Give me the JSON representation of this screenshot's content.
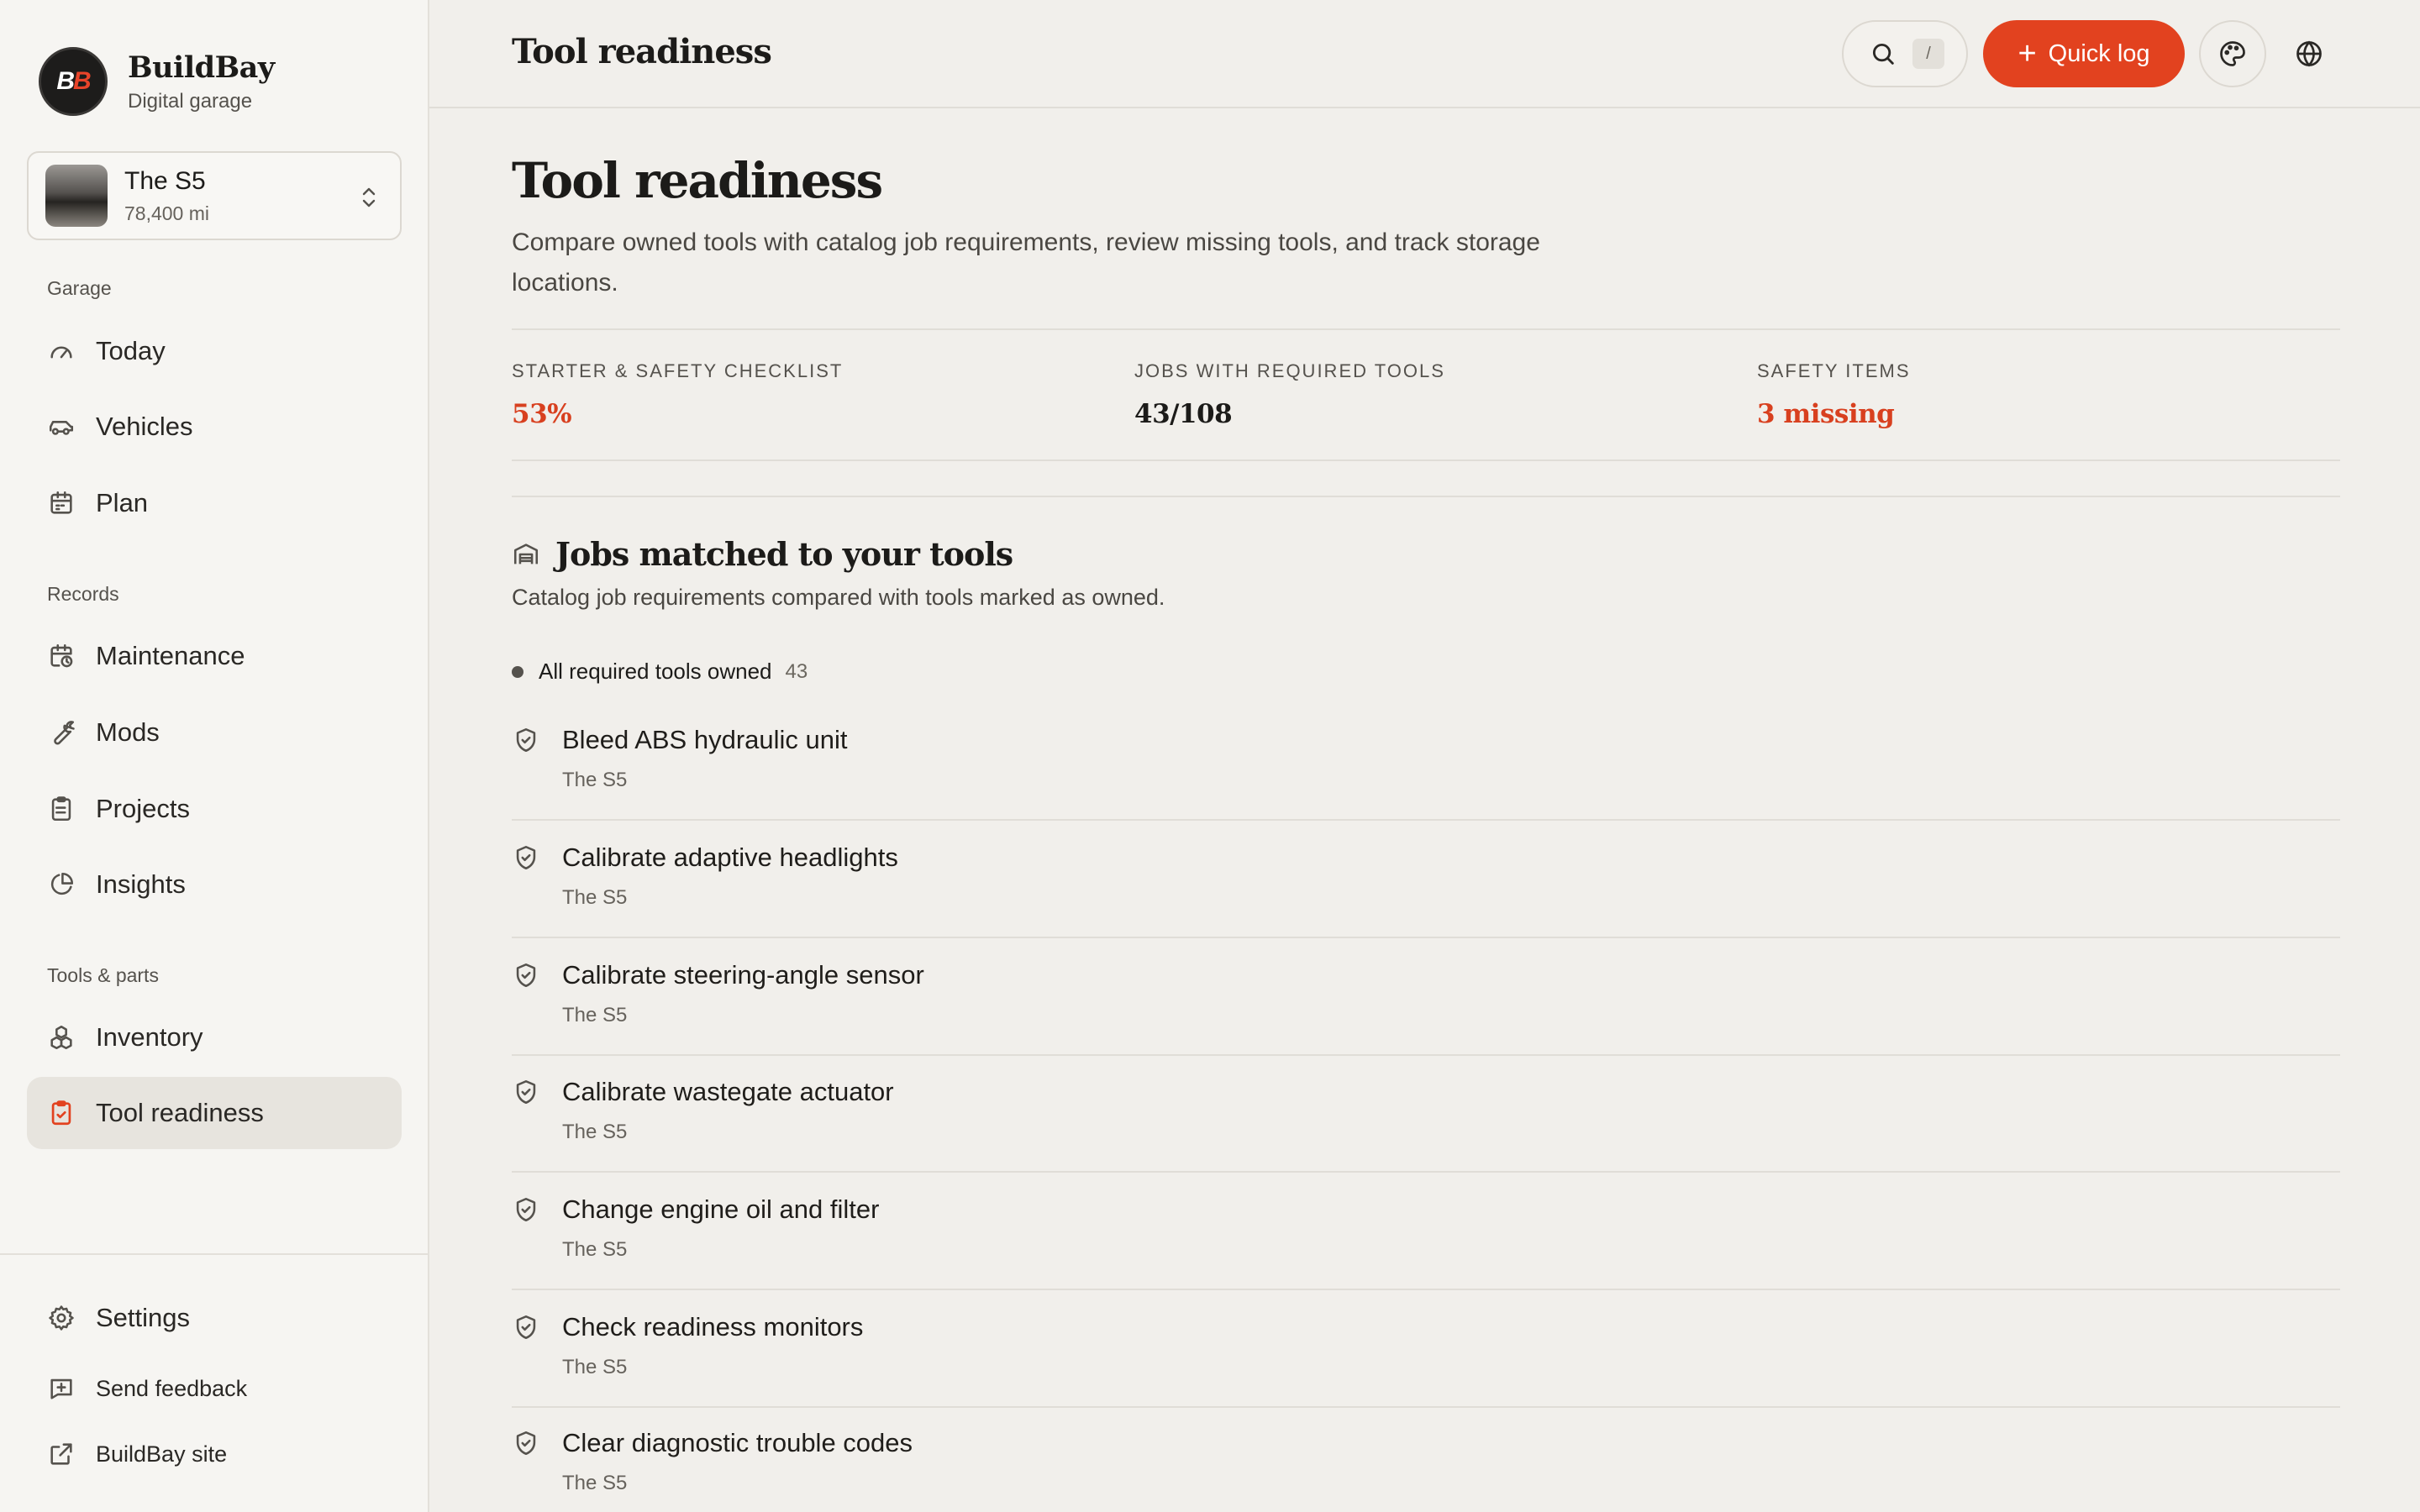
{
  "app": {
    "name": "BuildBay",
    "subtitle": "Digital garage",
    "logo_text_a": "B",
    "logo_text_b": "B"
  },
  "vehicle": {
    "name": "The S5",
    "mileage": "78,400 mi"
  },
  "sidebar": {
    "sections": [
      {
        "title": "Garage",
        "items": [
          {
            "label": "Today",
            "icon": "gauge-icon"
          },
          {
            "label": "Vehicles",
            "icon": "car-icon"
          },
          {
            "label": "Plan",
            "icon": "calendar-icon"
          }
        ]
      },
      {
        "title": "Records",
        "items": [
          {
            "label": "Maintenance",
            "icon": "calendar-clock-icon"
          },
          {
            "label": "Mods",
            "icon": "wrench-icon"
          },
          {
            "label": "Projects",
            "icon": "clipboard-list-icon"
          },
          {
            "label": "Insights",
            "icon": "pie-chart-icon"
          }
        ]
      },
      {
        "title": "Tools & parts",
        "items": [
          {
            "label": "Inventory",
            "icon": "boxes-icon"
          },
          {
            "label": "Tool readiness",
            "icon": "clipboard-check-icon",
            "active": true
          }
        ]
      }
    ],
    "footer": [
      {
        "label": "Settings",
        "icon": "gear-icon"
      },
      {
        "label": "Send feedback",
        "icon": "message-plus-icon"
      },
      {
        "label": "BuildBay site",
        "icon": "external-link-icon"
      }
    ]
  },
  "topbar": {
    "title": "Tool readiness",
    "search_shortcut": "/",
    "quick_log_label": "Quick log"
  },
  "page": {
    "title": "Tool readiness",
    "description": "Compare owned tools with catalog job requirements, review missing tools, and track storage locations."
  },
  "stats": [
    {
      "label": "STARTER & SAFETY CHECKLIST",
      "value": "53%",
      "emphasis": true
    },
    {
      "label": "JOBS WITH REQUIRED TOOLS",
      "value": "43/108",
      "emphasis": false
    },
    {
      "label": "SAFETY ITEMS",
      "value": "3 missing",
      "emphasis": true
    }
  ],
  "jobs_section": {
    "title": "Jobs matched to your tools",
    "subtitle": "Catalog job requirements compared with tools marked as owned.",
    "group_label": "All required tools owned",
    "group_count": "43",
    "jobs": [
      {
        "title": "Bleed ABS hydraulic unit",
        "vehicle": "The S5"
      },
      {
        "title": "Calibrate adaptive headlights",
        "vehicle": "The S5"
      },
      {
        "title": "Calibrate steering-angle sensor",
        "vehicle": "The S5"
      },
      {
        "title": "Calibrate wastegate actuator",
        "vehicle": "The S5"
      },
      {
        "title": "Change engine oil and filter",
        "vehicle": "The S5"
      },
      {
        "title": "Check readiness monitors",
        "vehicle": "The S5"
      },
      {
        "title": "Clear diagnostic trouble codes",
        "vehicle": "The S5"
      }
    ]
  },
  "colors": {
    "accent": "#e2421f",
    "accent_text": "#d8401f",
    "background": "#f1efeb",
    "sidebar": "#f6f5f2"
  }
}
